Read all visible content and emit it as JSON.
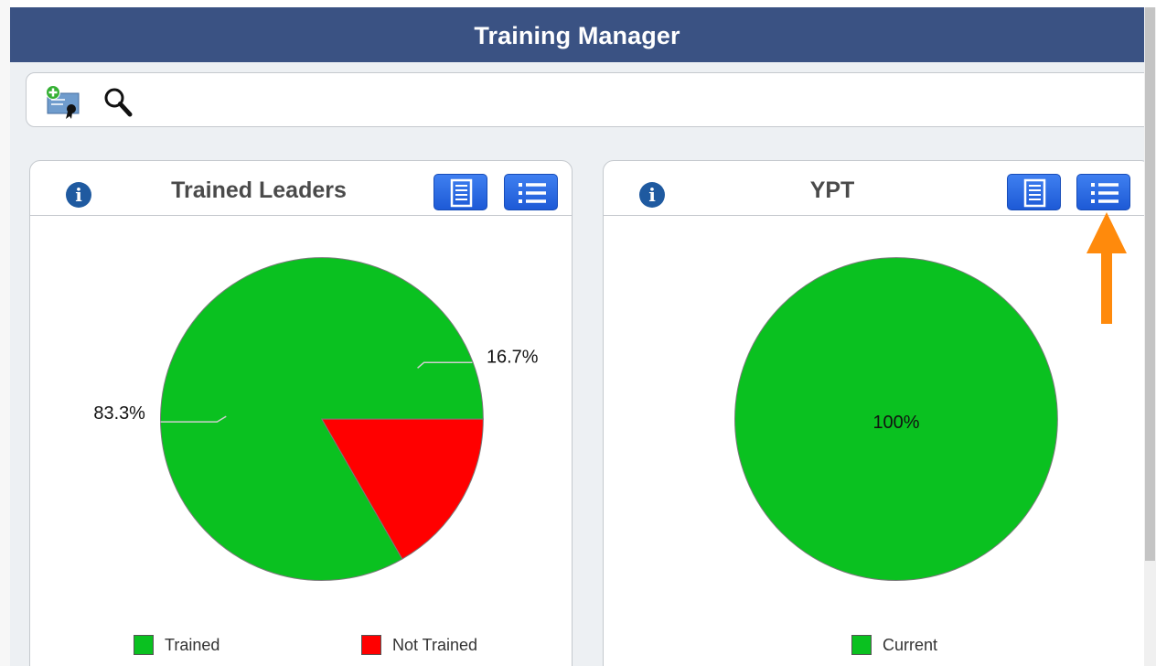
{
  "app": {
    "title": "Training Manager"
  },
  "toolbar": {
    "add_icon": "add-certificate-icon",
    "search_icon": "search-icon"
  },
  "panels": [
    {
      "title": "Trained Leaders",
      "info_icon": "info-icon",
      "view_buttons": [
        "report-view-icon",
        "list-view-icon"
      ],
      "legend": [
        {
          "label": "Trained",
          "color": "#0ac120"
        },
        {
          "label": "Not Trained",
          "color": "#ff0000"
        }
      ]
    },
    {
      "title": "YPT",
      "info_icon": "info-icon",
      "view_buttons": [
        "report-view-icon",
        "list-view-icon"
      ],
      "legend": [
        {
          "label": "Current",
          "color": "#0ac120"
        }
      ]
    }
  ],
  "chart_data": [
    {
      "type": "pie",
      "categories": [
        "Trained",
        "Not Trained"
      ],
      "values": [
        83.3,
        16.7
      ],
      "data_labels": [
        "83.3%",
        "16.7%"
      ],
      "colors": [
        "#0ac120",
        "#ff0000"
      ],
      "title": "Trained Leaders",
      "legend": "bottom"
    },
    {
      "type": "pie",
      "categories": [
        "Current"
      ],
      "values": [
        100
      ],
      "data_labels": [
        "100%"
      ],
      "colors": [
        "#0ac120"
      ],
      "title": "YPT",
      "legend": "bottom"
    }
  ],
  "annotation": {
    "arrow_color": "#ff8a0c"
  }
}
